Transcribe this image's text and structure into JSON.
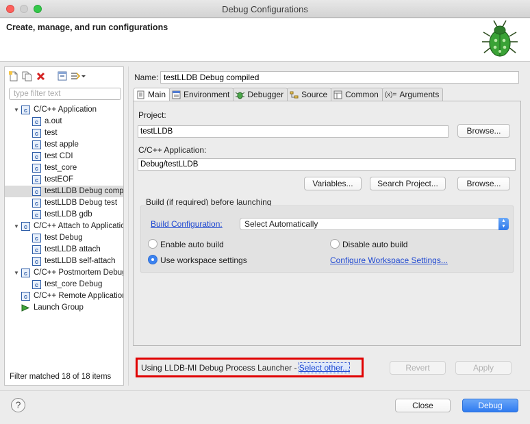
{
  "window": {
    "title": "Debug Configurations"
  },
  "header": {
    "title": "Create, manage, and run configurations"
  },
  "filter": {
    "placeholder": "type filter text"
  },
  "tree": [
    {
      "label": "C/C++ Application",
      "level": 0,
      "expanded": true
    },
    {
      "label": "a.out",
      "level": 1
    },
    {
      "label": "test",
      "level": 1
    },
    {
      "label": "test apple",
      "level": 1
    },
    {
      "label": "test CDI",
      "level": 1
    },
    {
      "label": "test_core",
      "level": 1
    },
    {
      "label": "testEOF",
      "level": 1
    },
    {
      "label": "testLLDB Debug compiled",
      "level": 1,
      "selected": true
    },
    {
      "label": "testLLDB Debug test",
      "level": 1
    },
    {
      "label": "testLLDB gdb",
      "level": 1
    },
    {
      "label": "C/C++ Attach to Application",
      "level": 0,
      "expanded": true
    },
    {
      "label": "test Debug",
      "level": 1
    },
    {
      "label": "testLLDB attach",
      "level": 1
    },
    {
      "label": "testLLDB self-attach",
      "level": 1
    },
    {
      "label": "C/C++ Postmortem Debugger",
      "level": 0,
      "expanded": true
    },
    {
      "label": "test_core Debug",
      "level": 1
    },
    {
      "label": "C/C++ Remote Application",
      "level": 0,
      "expanded": false
    },
    {
      "label": "Launch Group",
      "level": 0,
      "expanded": false,
      "launch": true
    }
  ],
  "filter_status": "Filter matched 18 of 18 items",
  "config": {
    "name_label": "Name:",
    "name_value": "testLLDB Debug compiled",
    "tabs": [
      "Main",
      "Environment",
      "Debugger",
      "Source",
      "Common",
      "Arguments"
    ],
    "project_label": "Project:",
    "project_value": "testLLDB",
    "browse_label": "Browse...",
    "app_label": "C/C++ Application:",
    "app_value": "Debug/testLLDB",
    "variables_label": "Variables...",
    "search_project_label": "Search Project...",
    "build_group_label": "Build (if required) before launching",
    "build_config_link": "Build Configuration:",
    "build_config_value": "Select Automatically",
    "enable_auto_build": "Enable auto build",
    "disable_auto_build": "Disable auto build",
    "use_workspace": "Use workspace settings",
    "configure_workspace_link": "Configure Workspace Settings..."
  },
  "launcher": {
    "text": "Using LLDB-MI Debug Process Launcher - ",
    "link": "Select other..."
  },
  "actions": {
    "revert": "Revert",
    "apply": "Apply",
    "close": "Close",
    "debug": "Debug",
    "help": "?"
  }
}
